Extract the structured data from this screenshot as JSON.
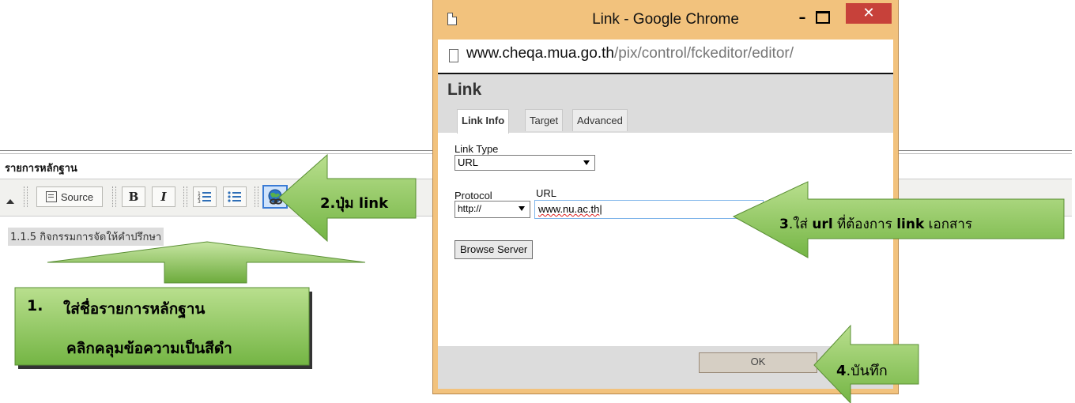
{
  "editor": {
    "title": "รายการหลักฐาน",
    "toolbar": {
      "source_label": "Source",
      "bold_label": "B",
      "italic_label": "I"
    },
    "content_text": "1.1.5  กิจกรรมการจัดให้คำปรึกษา"
  },
  "window": {
    "title": "Link - Google Chrome",
    "url_host": "www.cheqa.mua.go.th",
    "url_path": "/pix/control/fckeditor/editor/",
    "minimize_glyph": "–",
    "close_glyph": "✕"
  },
  "dialog": {
    "heading": "Link",
    "tabs": [
      "Link Info",
      "Target",
      "Advanced"
    ],
    "link_type_label": "Link Type",
    "link_type_value": "URL",
    "protocol_label": "Protocol",
    "protocol_value": "http://",
    "url_label": "URL",
    "url_value": "www.nu.ac.th",
    "browse_label": "Browse Server",
    "ok_label": "OK"
  },
  "annotations": {
    "step1_number": "1.",
    "step1_line1": "ใส่ชื่อรายการหลักฐาน",
    "step1_line2": "คลิกคลุมข้อความเป็นสีดำ",
    "step2": "2.ปุ่ม link",
    "step3_number": "3",
    "step3_text": ".ใส่ ",
    "step3_url": "url",
    "step3_text2": " ที่ต้องการ ",
    "step3_link": "link",
    "step3_text3": " เอกสาร",
    "step4_number": "4",
    "step4_text": ".บันทึก"
  },
  "colors": {
    "arrow_fill_top": "#c2e29c",
    "arrow_fill_bottom": "#6fae3f",
    "arrow_stroke": "#5a8f34",
    "popup_frame": "#f2c27d",
    "close_button": "#c7413a"
  },
  "icons": [
    "document-icon",
    "page-icon",
    "minimize-icon",
    "maximize-icon",
    "close-icon",
    "source-icon",
    "numbered-list-icon",
    "bulleted-list-icon",
    "link-icon",
    "dropdown-arrow-icon"
  ]
}
